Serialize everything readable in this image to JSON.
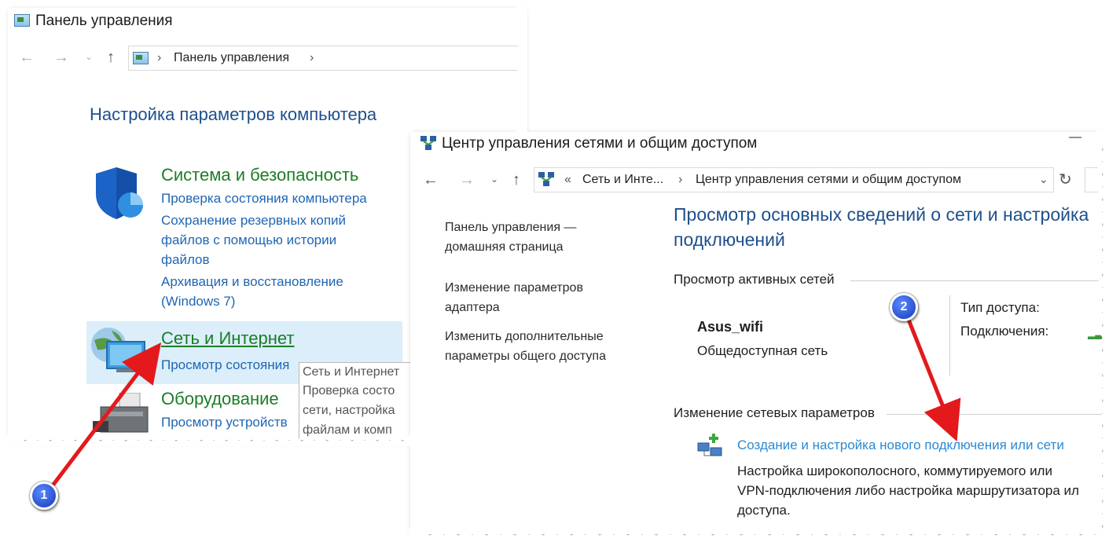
{
  "cp_window": {
    "title": "Панель управления",
    "breadcrumb": [
      "Панель управления"
    ],
    "heading": "Настройка параметров компьютера",
    "categories": [
      {
        "title": "Система и безопасность",
        "links": [
          "Проверка состояния компьютера",
          "Сохранение резервных копий",
          "файлов с помощью истории",
          "файлов",
          "Архивация и восстановление",
          "(Windows 7)"
        ]
      },
      {
        "title": "Сеть и Интернет",
        "links": [
          "Просмотр состояния"
        ]
      },
      {
        "title": "Оборудование",
        "links": [
          "Просмотр устройств"
        ]
      }
    ],
    "tooltip": [
      "Сеть и Интернет",
      "Проверка состо",
      "сети, настройка",
      "файлам и комп"
    ]
  },
  "nc_window": {
    "title": "Центр управления сетями и общим доступом",
    "minimize": "—",
    "breadcrumb_prefix": "«",
    "breadcrumb": [
      "Сеть и Инте...",
      "Центр управления сетями и общим доступом"
    ],
    "refresh": "↻",
    "sidebar": [
      [
        "Панель управления —",
        "домашняя страница"
      ],
      [
        "Изменение параметров",
        "адаптера"
      ],
      [
        "Изменить дополнительные",
        "параметры общего доступа"
      ]
    ],
    "heading": [
      "Просмотр основных сведений о сети и настройка",
      "подключений"
    ],
    "active_networks_label": "Просмотр активных сетей",
    "network_name": "Asus_wifi",
    "network_type": "Общедоступная сеть",
    "access_type_label": "Тип доступа:",
    "connections_label": "Подключения:",
    "change_settings_label": "Изменение сетевых параметров",
    "new_connection_link": "Создание и настройка нового подключения или сети",
    "new_connection_desc": [
      "Настройка широкополосного, коммутируемого или",
      "VPN-подключения либо настройка маршрутизатора ил",
      "доступа."
    ]
  },
  "annotations": {
    "badge1": "1",
    "badge2": "2"
  }
}
